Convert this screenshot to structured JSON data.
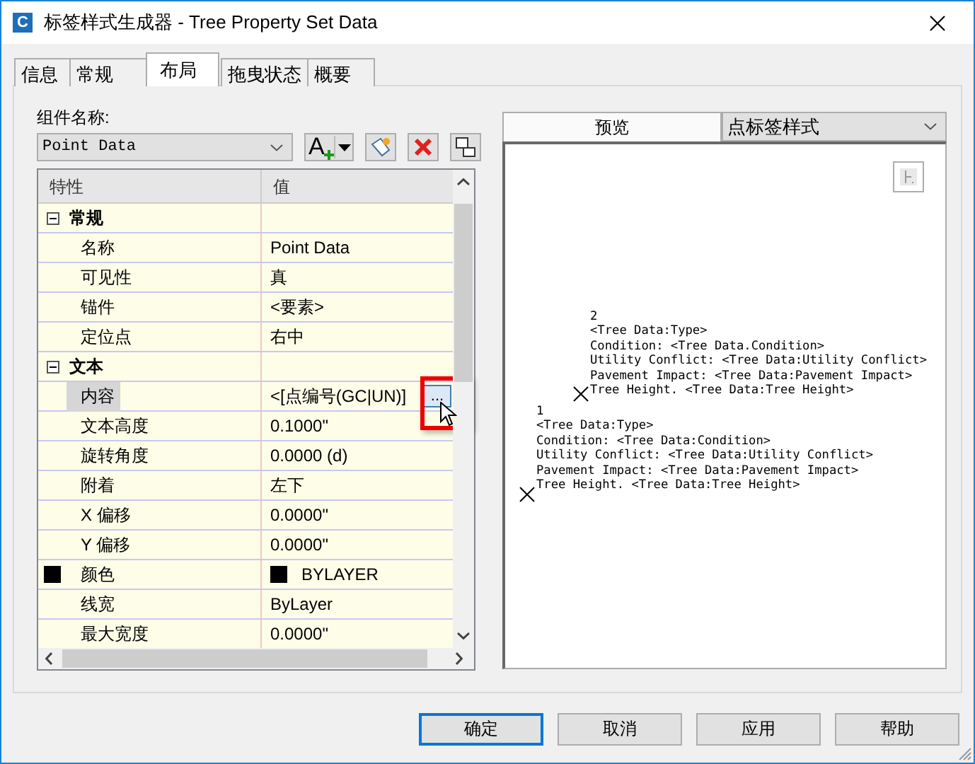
{
  "window": {
    "title": "标签样式生成器 - Tree Property Set Data",
    "app_icon": "C"
  },
  "tabs": [
    {
      "label": "信息",
      "selected": false
    },
    {
      "label": "常规",
      "selected": false
    },
    {
      "label": "布局",
      "selected": true
    },
    {
      "label": "拖曳状态",
      "selected": false
    },
    {
      "label": "概要",
      "selected": false
    }
  ],
  "component": {
    "label": "组件名称:",
    "value": "Point Data",
    "add_button_letter": "A"
  },
  "property_grid": {
    "columns": [
      "特性",
      "值"
    ],
    "groups": [
      {
        "name": "常规",
        "expanded": true,
        "rows": [
          {
            "name": "名称",
            "value": "Point Data",
            "selected": false
          },
          {
            "name": "可见性",
            "value": "真",
            "selected": false
          },
          {
            "name": "锚件",
            "value": "<要素>",
            "selected": false
          },
          {
            "name": "定位点",
            "value": "右中",
            "selected": false
          }
        ]
      },
      {
        "name": "文本",
        "expanded": true,
        "rows": [
          {
            "name": "内容",
            "value": "<[点编号(GC|UN)]",
            "selected": true,
            "button": "...",
            "highlighted": true
          },
          {
            "name": "文本高度",
            "value": "0.1000\"",
            "selected": false
          },
          {
            "name": "旋转角度",
            "value": "0.0000 (d)",
            "selected": false
          },
          {
            "name": "附着",
            "value": "左下",
            "selected": false
          },
          {
            "name": "X 偏移",
            "value": "0.0000\"",
            "selected": false
          },
          {
            "name": "Y 偏移",
            "value": "0.0000\"",
            "selected": false
          },
          {
            "name": "颜色",
            "value": "BYLAYER",
            "selected": false,
            "color": "#000000"
          },
          {
            "name": "线宽",
            "value": "ByLayer",
            "selected": false
          },
          {
            "name": "最大宽度",
            "value": "0.0000\"",
            "selected": false
          }
        ]
      }
    ]
  },
  "preview": {
    "tab": "预览",
    "style": "点标签样式",
    "labels": [
      {
        "lines": [
          "2",
          "<Tree Data:Type>",
          "Condition: <Tree Data.Condition>",
          "Utility Conflict: <Tree Data:Utility Conflict>",
          "Pavement Impact: <Tree Data:Pavement Impact>",
          "Tree Height. <Tree Data:Tree Height>"
        ]
      },
      {
        "lines": [
          "1",
          "<Tree Data:Type>",
          "Condition: <Tree Data:Condition>",
          "Utility Conflict: <Tree Data:Utility Conflict>",
          "Pavement Impact: <Tree Data:Pavement Impact>",
          "Tree Height. <Tree Data:Tree Height>"
        ]
      }
    ]
  },
  "buttons": [
    {
      "label": "确定",
      "default": true
    },
    {
      "label": "取消",
      "default": false
    },
    {
      "label": "应用",
      "default": false
    },
    {
      "label": "帮助",
      "default": false
    }
  ]
}
